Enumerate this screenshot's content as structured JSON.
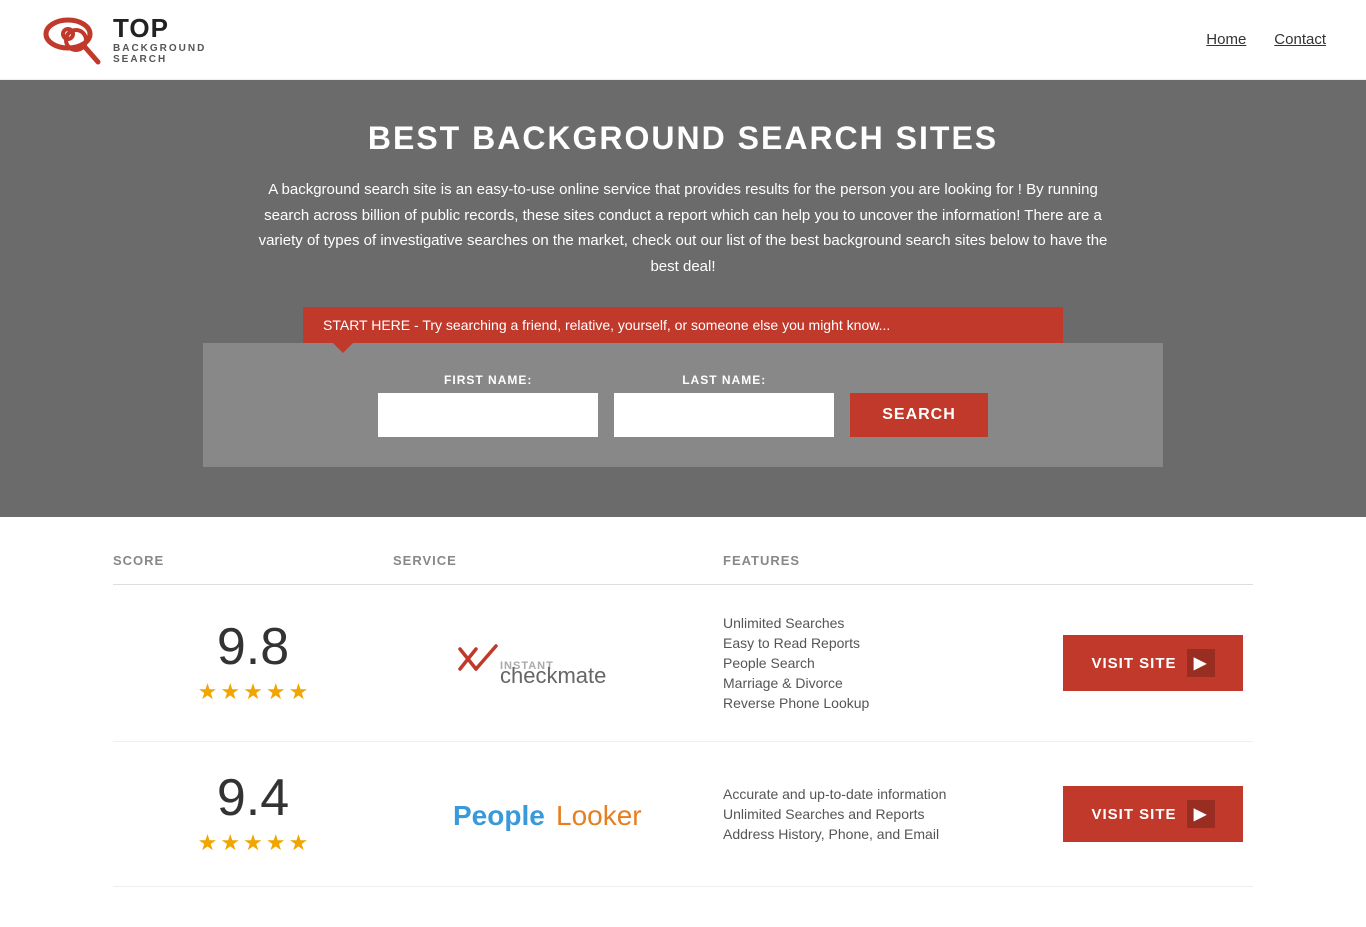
{
  "header": {
    "logo_top": "TOP",
    "logo_sub": "BACKGROUND\nSEARCH",
    "nav": [
      {
        "label": "Home",
        "href": "#"
      },
      {
        "label": "Contact",
        "href": "#"
      }
    ]
  },
  "hero": {
    "title": "BEST BACKGROUND SEARCH SITES",
    "description": "A background search site is an easy-to-use online service that provides results  for the person you are looking for ! By  running  search across billion of public records, these sites conduct  a report which can help you to uncover the information! There are a variety of types of investigative searches on the market, check out our  list of the best background search sites below to have the best deal!",
    "callout": "START HERE - Try searching a friend, relative, yourself, or someone else you might know...",
    "form": {
      "first_name_label": "FIRST NAME:",
      "last_name_label": "LAST NAME:",
      "search_button": "SEARCH"
    }
  },
  "table": {
    "headers": {
      "score": "SCORE",
      "service": "SERVICE",
      "features": "FEATURES",
      "action": ""
    },
    "rows": [
      {
        "score": "9.8",
        "stars": 4.5,
        "service_name": "Instant Checkmate",
        "features": [
          "Unlimited Searches",
          "Easy to Read Reports",
          "People Search",
          "Marriage & Divorce",
          "Reverse Phone Lookup"
        ],
        "visit_label": "VISIT SITE"
      },
      {
        "score": "9.4",
        "stars": 4.5,
        "service_name": "PeopleLooker",
        "features": [
          "Accurate and up-to-date information",
          "Unlimited Searches and Reports",
          "Address History, Phone, and Email"
        ],
        "visit_label": "VISIT SITE"
      }
    ]
  }
}
